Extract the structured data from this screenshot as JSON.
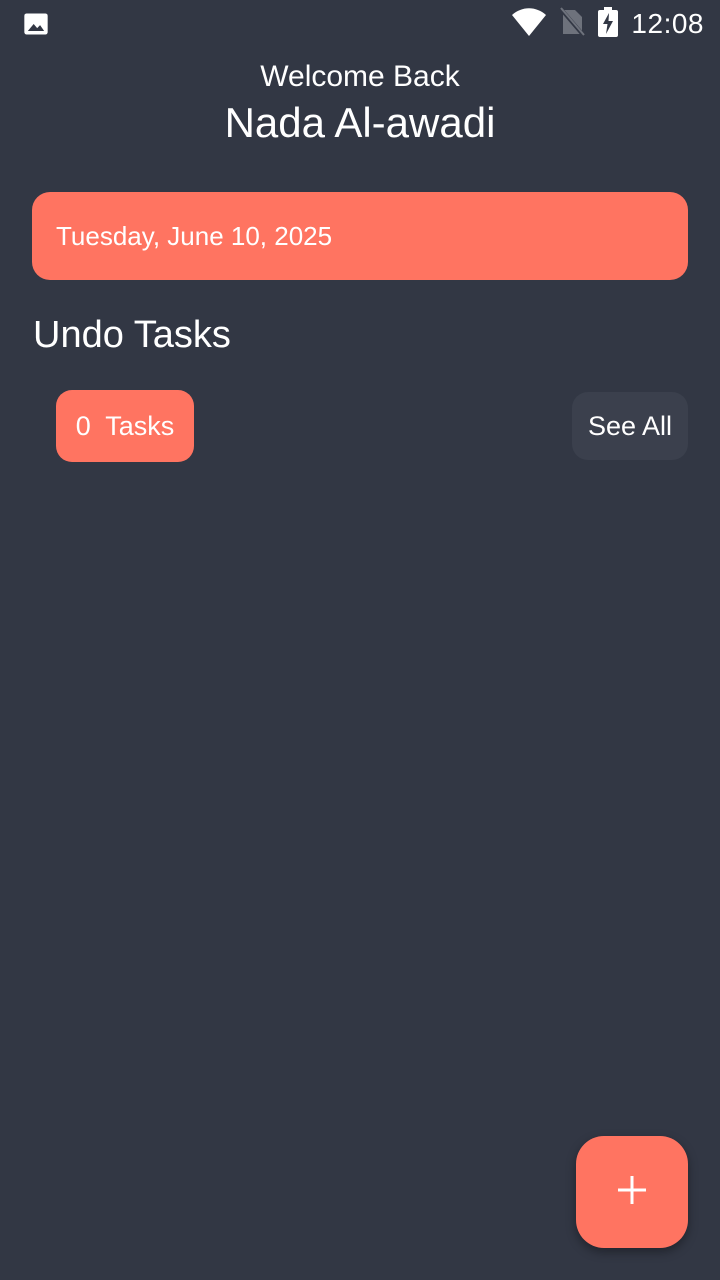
{
  "status_bar": {
    "left_icon": "image-icon",
    "icons": [
      "wifi-icon",
      "no-sim-icon",
      "battery-charging-icon"
    ],
    "time": "12:08"
  },
  "header": {
    "greeting": "Welcome Back",
    "user_name": "Nada Al-awadi"
  },
  "date_card": {
    "date": "Tuesday, June 10, 2025"
  },
  "tasks_section": {
    "title": "Undo Tasks",
    "count_label": "0  Tasks",
    "see_all_label": "See All"
  },
  "fab": {
    "icon": "plus-icon"
  },
  "colors": {
    "background": "#323744",
    "accent": "#ff7461",
    "button_secondary": "#3b404d",
    "text": "#ffffff"
  }
}
